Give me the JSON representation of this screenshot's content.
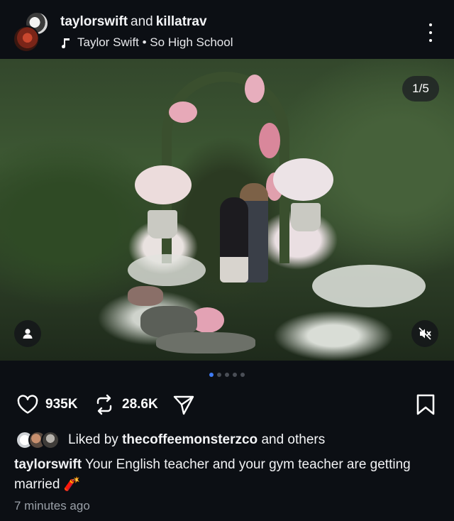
{
  "header": {
    "user1": "taylorswift",
    "connector": "and",
    "user2": "killatrav",
    "song": "Taylor Swift • So High School",
    "song_icon": "music-note-icon",
    "more_icon": "more-vertical-icon"
  },
  "media": {
    "counter": "1/5",
    "tag_icon": "person-icon",
    "mute_icon": "speaker-muted-icon",
    "current_slide": 1,
    "total_slides": 5
  },
  "actions": {
    "like_count": "935K",
    "repost_count": "28.6K",
    "like_icon": "heart-icon",
    "repost_icon": "repost-icon",
    "share_icon": "send-icon",
    "save_icon": "bookmark-icon"
  },
  "likes": {
    "prefix": "Liked by",
    "user": "thecoffeemonsterzco",
    "suffix": "and others"
  },
  "caption": {
    "user": "taylorswift",
    "text": "Your English teacher and your gym teacher are getting married 🧨"
  },
  "timestamp": "7 minutes ago",
  "colors": {
    "background": "#0c0f14",
    "accent": "#3e7bf5"
  }
}
